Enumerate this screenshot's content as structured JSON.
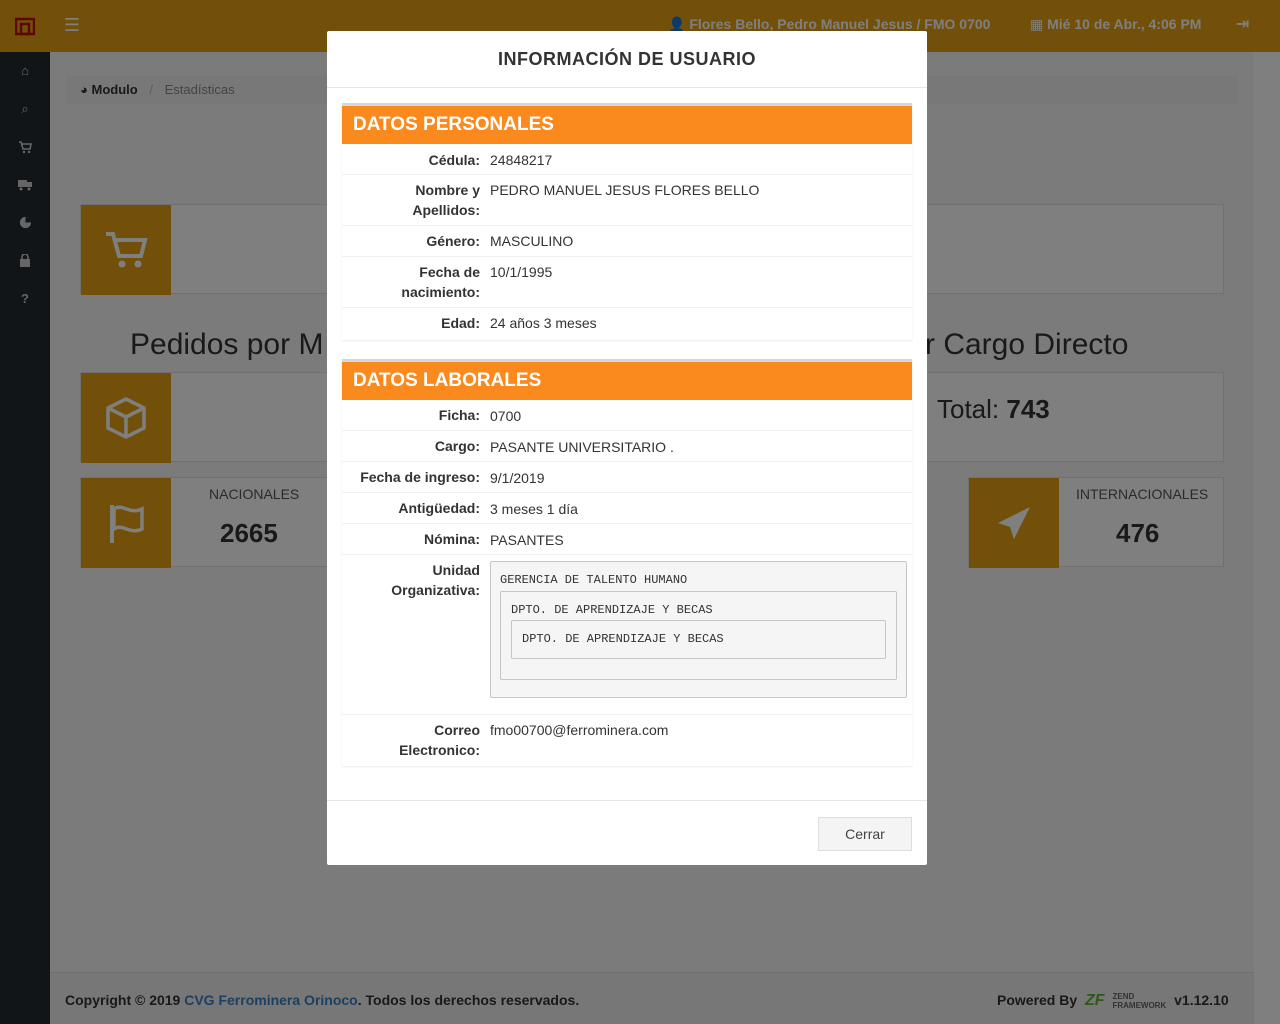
{
  "topbar": {
    "menu_icon": "☰",
    "user": "Flores Bello, Pedro Manuel Jesus / FMO 0700",
    "date": "Mié 10 de Abr., 4:06 PM",
    "logout_icon": "⇥"
  },
  "sidebar": {
    "items": [
      {
        "icon": "home-icon",
        "glyph": "⌂"
      },
      {
        "icon": "search-icon",
        "glyph": "⌕"
      },
      {
        "icon": "cart-icon",
        "glyph": "🛒"
      },
      {
        "icon": "truck-icon",
        "glyph": "⛟"
      },
      {
        "icon": "pie-chart-icon",
        "glyph": "◔"
      },
      {
        "icon": "lock-icon",
        "glyph": "🔒"
      },
      {
        "icon": "help-icon",
        "glyph": "?"
      }
    ]
  },
  "breadcrumb": {
    "module": "Modulo",
    "current": "Estadísticas"
  },
  "dashboard": {
    "heading_left": "Pedidos por M",
    "heading_right": "r Cargo Directo",
    "total_label": "Total:",
    "total_value": "743",
    "nacionales_label": "NACIONALES",
    "nacionales_value": "2665",
    "internacionales_label": "INTERNACIONALES",
    "internacionales_value": "476"
  },
  "modal": {
    "title": "INFORMACIÓN DE USUARIO",
    "personal": {
      "heading": "DATOS PERSONALES",
      "cedula_label": "Cédula:",
      "cedula": "24848217",
      "nombre_label_1": "Nombre y",
      "nombre_label_2": "Apellidos:",
      "nombre": "PEDRO MANUEL JESUS FLORES BELLO",
      "genero_label": "Género:",
      "genero": "MASCULINO",
      "nacimiento_label_1": "Fecha de",
      "nacimiento_label_2": "nacimiento:",
      "nacimiento": "10/1/1995",
      "edad_label": "Edad:",
      "edad": "24 años 3 meses"
    },
    "laboral": {
      "heading": "DATOS LABORALES",
      "ficha_label": "Ficha:",
      "ficha": "0700",
      "cargo_label": "Cargo:",
      "cargo": "PASANTE UNIVERSITARIO .",
      "ingreso_label": "Fecha de ingreso:",
      "ingreso": "9/1/2019",
      "antiguedad_label": "Antigüedad:",
      "antiguedad": "3 meses 1 día",
      "nomina_label": "Nómina:",
      "nomina": "PASANTES",
      "unidad_label_1": "Unidad",
      "unidad_label_2": "Organizativa:",
      "unidad_l1": "GERENCIA DE TALENTO HUMANO",
      "unidad_l2": "DPTO. DE APRENDIZAJE Y BECAS",
      "unidad_l3": "DPTO. DE APRENDIZAJE Y BECAS",
      "correo_label_1": "Correo",
      "correo_label_2": "Electronico:",
      "correo": "fmo00700@ferrominera.com"
    },
    "close_label": "Cerrar"
  },
  "footer": {
    "copy_prefix": "Copyright © 2019 ",
    "company": "CVG Ferrominera Orinoco",
    "copy_suffix": ". Todos los derechos reservados.",
    "powered": "Powered By",
    "zf_logo": "ZF",
    "zf_line1": "ZEND",
    "zf_line2": "FRAMEWORK",
    "version": "v1.12.10"
  },
  "colors": {
    "accent": "#e6a012",
    "section_header": "#fb8a1e",
    "sidebar": "#222a30"
  }
}
